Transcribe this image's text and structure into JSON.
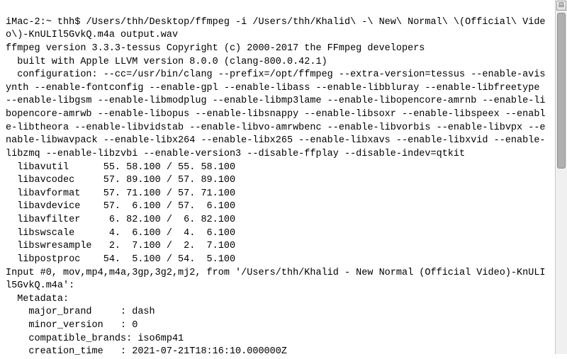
{
  "prompt": "iMac-2:~ thh$ /Users/thh/Desktop/ffmpeg -i /Users/thh/Khalid\\ -\\ New\\ Normal\\ \\(Official\\ Video\\)-KnULIl5GvkQ.m4a output.wav",
  "banner": "ffmpeg version 3.3.3-tessus Copyright (c) 2000-2017 the FFmpeg developers",
  "built": "  built with Apple LLVM version 8.0.0 (clang-800.0.42.1)",
  "config": "  configuration: --cc=/usr/bin/clang --prefix=/opt/ffmpeg --extra-version=tessus --enable-avisynth --enable-fontconfig --enable-gpl --enable-libass --enable-libbluray --enable-libfreetype --enable-libgsm --enable-libmodplug --enable-libmp3lame --enable-libopencore-amrnb --enable-libopencore-amrwb --enable-libopus --enable-libsnappy --enable-libsoxr --enable-libspeex --enable-libtheora --enable-libvidstab --enable-libvo-amrwbenc --enable-libvorbis --enable-libvpx --enable-libwavpack --enable-libx264 --enable-libx265 --enable-libxavs --enable-libxvid --enable-libzmq --enable-libzvbi --enable-version3 --disable-ffplay --disable-indev=qtkit",
  "libs": [
    {
      "name": "libavutil",
      "ver_a": "55. 58.100",
      "ver_b": "55. 58.100"
    },
    {
      "name": "libavcodec",
      "ver_a": "57. 89.100",
      "ver_b": "57. 89.100"
    },
    {
      "name": "libavformat",
      "ver_a": "57. 71.100",
      "ver_b": "57. 71.100"
    },
    {
      "name": "libavdevice",
      "ver_a": "57.  6.100",
      "ver_b": "57.  6.100"
    },
    {
      "name": "libavfilter",
      "ver_a": " 6. 82.100",
      "ver_b": " 6. 82.100"
    },
    {
      "name": "libswscale",
      "ver_a": " 4.  6.100",
      "ver_b": " 4.  6.100"
    },
    {
      "name": "libswresample",
      "ver_a": " 2.  7.100",
      "ver_b": " 2.  7.100"
    },
    {
      "name": "libpostproc",
      "ver_a": "54.  5.100",
      "ver_b": "54.  5.100"
    }
  ],
  "input": "Input #0, mov,mp4,m4a,3gp,3g2,mj2, from '/Users/thh/Khalid - New Normal (Official Video)-KnULIl5GvkQ.m4a':",
  "metadata_label": "  Metadata:",
  "metadata": {
    "major_brand": "    major_brand     : dash",
    "minor_version": "    minor_version   : 0",
    "compatible_brands": "    compatible_brands: iso6mp41",
    "creation_time": "    creation_time   : 2021-07-21T18:16:10.000000Z"
  },
  "scroll": {
    "up_glyph": "▤"
  }
}
